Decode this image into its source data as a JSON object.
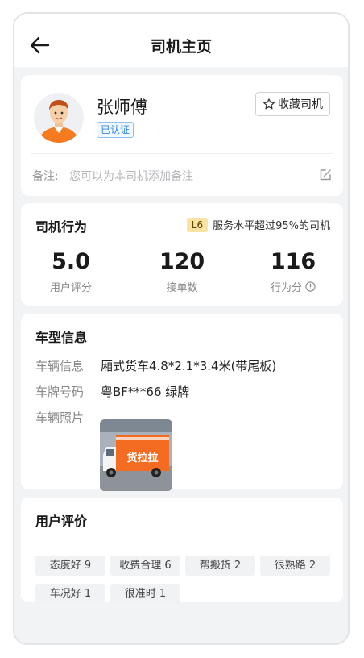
{
  "header": {
    "title": "司机主页"
  },
  "driver": {
    "name": "张师傅",
    "verified_label": "已认证",
    "favorite_label": "收藏司机",
    "note_label": "备注:",
    "note_placeholder": "您可以为本司机添加备注"
  },
  "behavior": {
    "title": "司机行为",
    "level_badge": "L6",
    "level_text": "服务水平超过95%的司机",
    "stats": [
      {
        "value": "5.0",
        "label": "用户评分"
      },
      {
        "value": "120",
        "label": "接单数"
      },
      {
        "value": "116",
        "label": "行为分"
      }
    ]
  },
  "vehicle": {
    "title": "车型信息",
    "info_label": "车辆信息",
    "info_value": "厢式货车4.8*2.1*3.4米(带尾板)",
    "plate_label": "车牌号码",
    "plate_value": "粤BF***66 绿牌",
    "photo_label": "车辆照片",
    "photo_text": "货拉拉"
  },
  "reviews": {
    "title": "用户评价",
    "tags": [
      "态度好 9",
      "收费合理 6",
      "帮搬货 2",
      "很熟路 2",
      "车况好 1",
      "很准时 1"
    ]
  },
  "colors": {
    "accent_blue": "#2f86e8",
    "level_badge_bg": "#fbe3a4",
    "truck_orange": "#f36c21"
  }
}
